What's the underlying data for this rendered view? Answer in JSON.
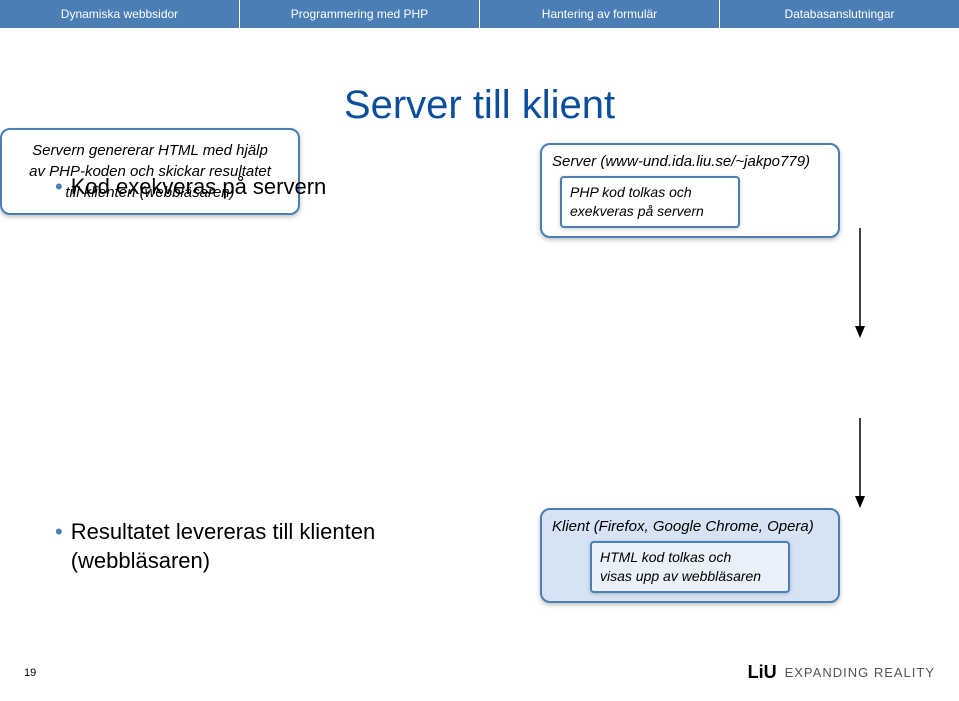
{
  "topbar": {
    "items": [
      "Dynamiska webbsidor",
      "Programmering med PHP",
      "Hantering av formulär",
      "Databasanslutningar"
    ]
  },
  "title": "Server till klient",
  "bullets": {
    "left_top": "Kod exekveras på servern",
    "left_bottom_l1": "Resultatet levereras till klienten",
    "left_bottom_l2": "(webbläsaren)"
  },
  "server_box": {
    "label": "Server (www-und.ida.liu.se/~jakpo779)",
    "inner_l1": "PHP kod tolkas och",
    "inner_l2": "exekveras på servern"
  },
  "middle_box": {
    "l1": "Servern genererar HTML med hjälp",
    "l2": "av PHP-koden och skickar resultatet",
    "l3": "till klienten (webbläsaren)"
  },
  "client_box": {
    "label": "Klient (Firefox, Google Chrome, Opera)",
    "inner_l1": "HTML kod tolkas och",
    "inner_l2": "visas upp av webbläsaren"
  },
  "footer": {
    "page": "19",
    "logo": "LiU",
    "tagline": "EXPANDING REALITY"
  }
}
